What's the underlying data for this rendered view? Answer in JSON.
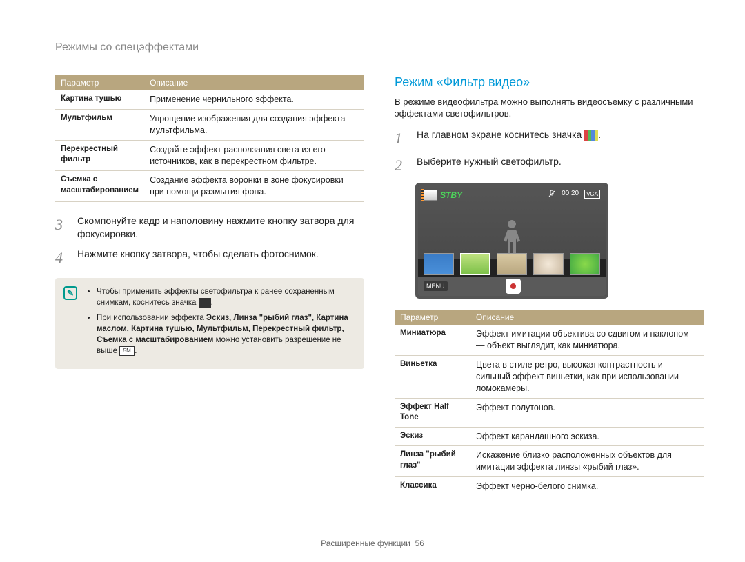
{
  "header": "Режимы со спецэффектами",
  "left": {
    "table_headers": {
      "param": "Параметр",
      "desc": "Описание"
    },
    "rows": [
      {
        "name": "Картина тушью",
        "desc": "Применение чернильного эффекта."
      },
      {
        "name": "Мультфильм",
        "desc": "Упрощение изображения для создания эффекта мультфильма."
      },
      {
        "name": "Перекрестный фильтр",
        "desc": "Создайте эффект расползания света из его источников, как в перекрестном фильтре."
      },
      {
        "name": "Съемка с масштабированием",
        "desc": "Создание эффекта воронки в зоне фокусировки при помощи размытия фона."
      }
    ],
    "steps": {
      "s3": "Скомпонуйте кадр и наполовину нажмите кнопку затвора для фокусировки.",
      "s4": "Нажмите кнопку затвора, чтобы сделать фотоснимок."
    },
    "notes": {
      "n1a": "Чтобы применить эффекты светофильтра к ранее сохраненным снимкам, коснитесь значка",
      "n1b": ".",
      "n2a": "При использовании эффекта ",
      "n2b": "Эскиз, Линза \"рыбий глаз\", Картина маслом, Картина тушью, Мультфильм, Перекрестный фильтр, Съемка с масштабированием",
      "n2c": " можно установить разрешение не выше ",
      "n2_res": "5M",
      "n2d": "."
    }
  },
  "right": {
    "title": "Режим «Фильтр видео»",
    "desc": "В режиме видеофильтра можно выполнять видеосъемку с различными эффектами светофильтров.",
    "steps": {
      "s1a": "На главном экране коснитесь значка",
      "s1b": ".",
      "s2": "Выберите нужный светофильтр."
    },
    "cam": {
      "stby": "STBY",
      "time": "00:20",
      "vga": "VGA",
      "menu": "MENU"
    },
    "table_headers": {
      "param": "Параметр",
      "desc": "Описание"
    },
    "rows": [
      {
        "name": "Миниатюра",
        "desc": "Эффект имитации объектива со сдвигом и наклоном — объект выглядит, как миниатюра."
      },
      {
        "name": "Виньетка",
        "desc": "Цвета в стиле ретро, высокая контрастность и сильный эффект виньетки, как при использовании ломокамеры."
      },
      {
        "name": "Эффект Half Tone",
        "desc": "Эффект полутонов."
      },
      {
        "name": "Эскиз",
        "desc": "Эффект карандашного эскиза."
      },
      {
        "name": "Линза \"рыбий глаз\"",
        "desc": "Искажение близко расположенных объектов для имитации эффекта линзы «рыбий глаз»."
      },
      {
        "name": "Классика",
        "desc": "Эффект черно-белого снимка."
      }
    ]
  },
  "footer": {
    "section": "Расширенные функции",
    "page": "56"
  }
}
